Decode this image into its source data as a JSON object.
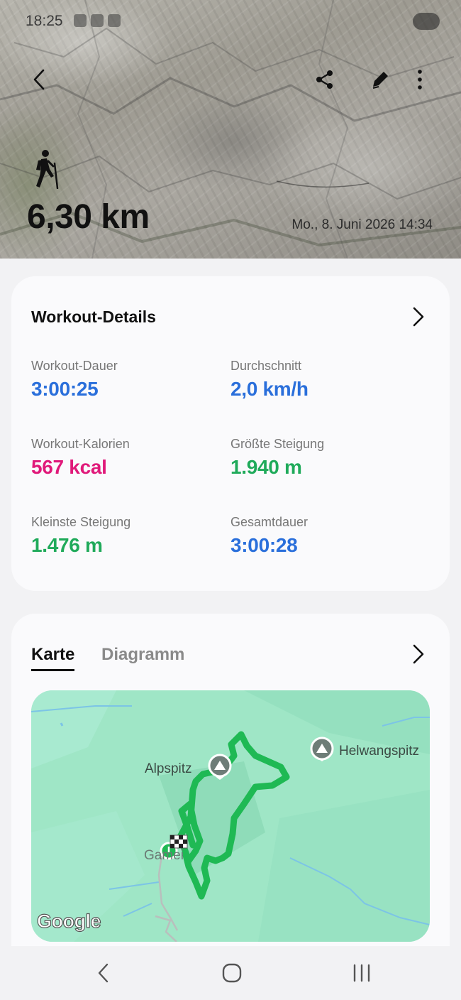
{
  "status_bar": {
    "time": "18:25"
  },
  "header": {
    "distance": "6,30 km",
    "datetime": "Mo., 8. Juni 2026 14:34",
    "icons": [
      "back-icon",
      "share-icon",
      "edit-icon",
      "more-icon",
      "hiking-icon"
    ]
  },
  "details": {
    "title": "Workout-Details",
    "metrics": [
      {
        "label": "Workout-Dauer",
        "value": "3:00:25",
        "color": "#2a6fdb"
      },
      {
        "label": "Durchschnitt",
        "value": "2,0 km/h",
        "color": "#2a6fdb"
      },
      {
        "label": "Workout-Kalorien",
        "value": "567 kcal",
        "color": "#e0197a"
      },
      {
        "label": "Größte Steigung",
        "value": "1.940 m",
        "color": "#1faa5a"
      },
      {
        "label": "Kleinste Steigung",
        "value": "1.476 m",
        "color": "#1faa5a"
      },
      {
        "label": "Gesamtdauer",
        "value": "3:00:28",
        "color": "#2a6fdb"
      }
    ]
  },
  "map_card": {
    "tabs": [
      {
        "label": "Karte",
        "active": true
      },
      {
        "label": "Diagramm",
        "active": false
      }
    ],
    "map_labels": {
      "alpspitz": "Alpspitz",
      "helwangspitz": "Helwangspitz",
      "garmi": "Gamei"
    },
    "google": "Google",
    "route_color": "#1fb954"
  },
  "navbar": {
    "icons": [
      "nav-back-icon",
      "nav-home-icon",
      "nav-recent-icon"
    ]
  }
}
